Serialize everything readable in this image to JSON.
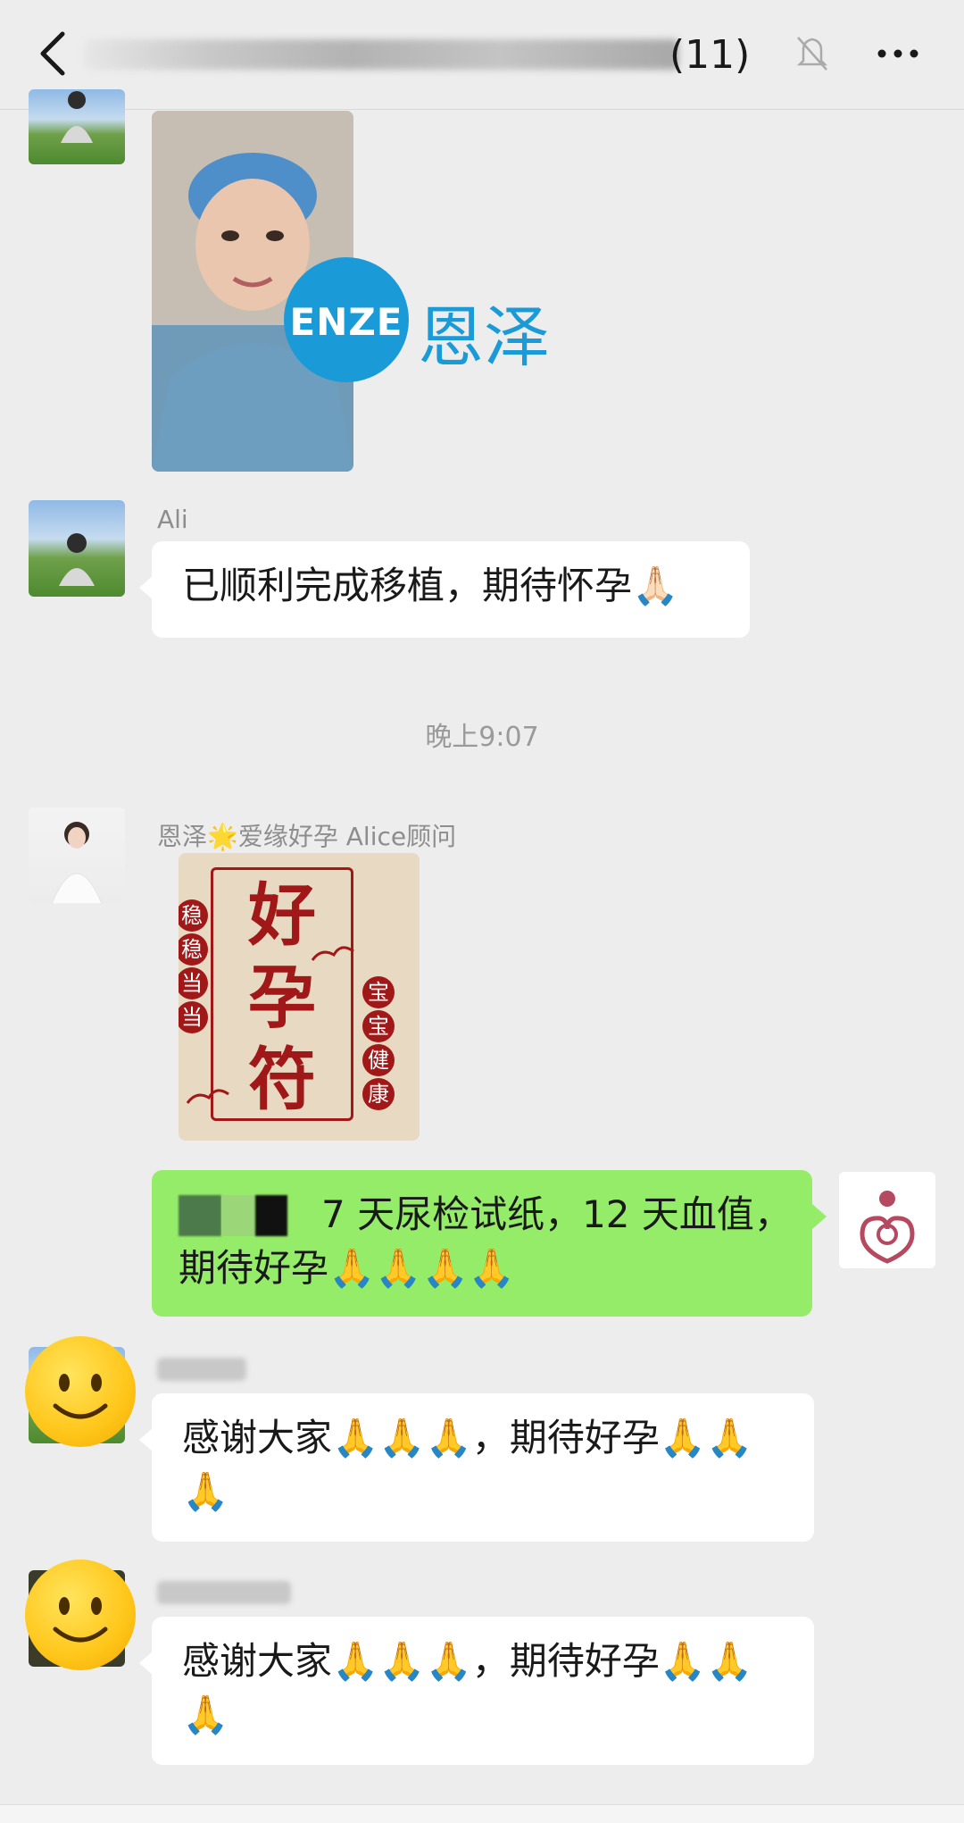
{
  "header": {
    "group_count": "(11)"
  },
  "messages": {
    "photo_brand": {
      "logo_text": "ENZE",
      "brand_cn": "恩泽"
    },
    "msg_ali": {
      "sender": "Ali",
      "text": "已顺利完成移植，期待怀孕🙏🏻"
    },
    "time": "晚上9:07",
    "msg_alice": {
      "sender": "恩泽🌟爱缘好孕 Alice顾问",
      "sticker": {
        "main": [
          "好",
          "孕",
          "符"
        ],
        "left": [
          "稳",
          "稳",
          "当",
          "当"
        ],
        "right": [
          "宝",
          "宝",
          "健",
          "康"
        ]
      }
    },
    "msg_self": {
      "line1": "7 天尿检试纸，12 天血值，",
      "line2": "期待好孕🙏🙏🙏🙏"
    },
    "msg_thanks1": {
      "line1": "感谢大家🙏🙏🙏，期待好孕🙏🙏",
      "line2": "🙏"
    },
    "msg_thanks2": {
      "line1": "感谢大家🙏🙏🙏，期待好孕🙏🙏",
      "line2": "🙏"
    }
  },
  "colors": {
    "bg": "#ededed",
    "bubble_self": "#95ec69",
    "bubble_other": "#ffffff",
    "brand_blue": "#1a9bd7",
    "sticker_red": "#a01818"
  }
}
